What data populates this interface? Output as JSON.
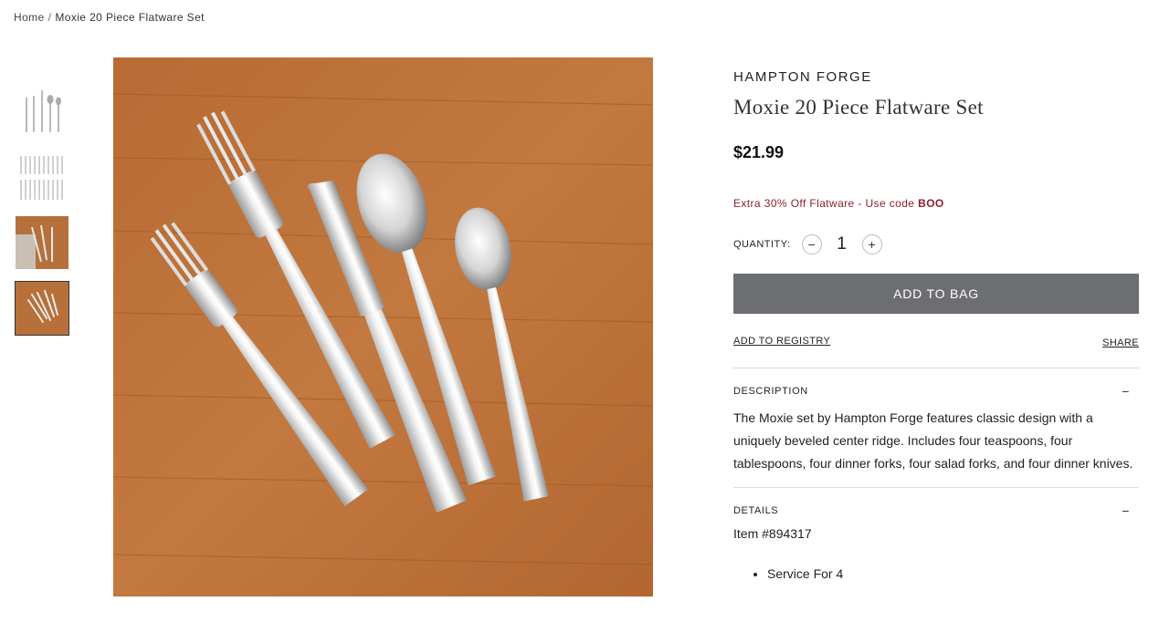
{
  "breadcrumb": {
    "home": "Home",
    "separator": "/",
    "current": "Moxie 20 Piece Flatware Set"
  },
  "gallery": {
    "thumbnails": [
      {
        "name": "flatware-set-5pc-white"
      },
      {
        "name": "flatware-set-20pc-white"
      },
      {
        "name": "flatware-napkin-wood"
      },
      {
        "name": "flatware-wood-active",
        "active": true
      }
    ]
  },
  "product": {
    "brand": "HAMPTON FORGE",
    "title": "Moxie 20 Piece Flatware Set",
    "price": "$21.99",
    "promo_text": "Extra 30% Off Flatware - Use code ",
    "promo_code": "BOO",
    "promo_color": "#8a2131",
    "quantity_label": "QUANTITY:",
    "quantity_value": "1",
    "minus_icon": "−",
    "plus_icon": "+",
    "add_to_bag": "ADD TO BAG",
    "add_to_bag_color": "#6d6e71",
    "add_to_registry": "ADD TO REGISTRY",
    "share": "SHARE"
  },
  "description": {
    "header": "DESCRIPTION",
    "toggle": "−",
    "text": "The Moxie set by Hampton Forge features classic design with a uniquely beveled center ridge. Includes four teaspoons, four tablespoons, four dinner forks, four salad forks, and four dinner knives."
  },
  "details": {
    "header": "DETAILS",
    "toggle": "−",
    "item_number": "Item #894317",
    "bullets": [
      "Service For 4"
    ]
  }
}
